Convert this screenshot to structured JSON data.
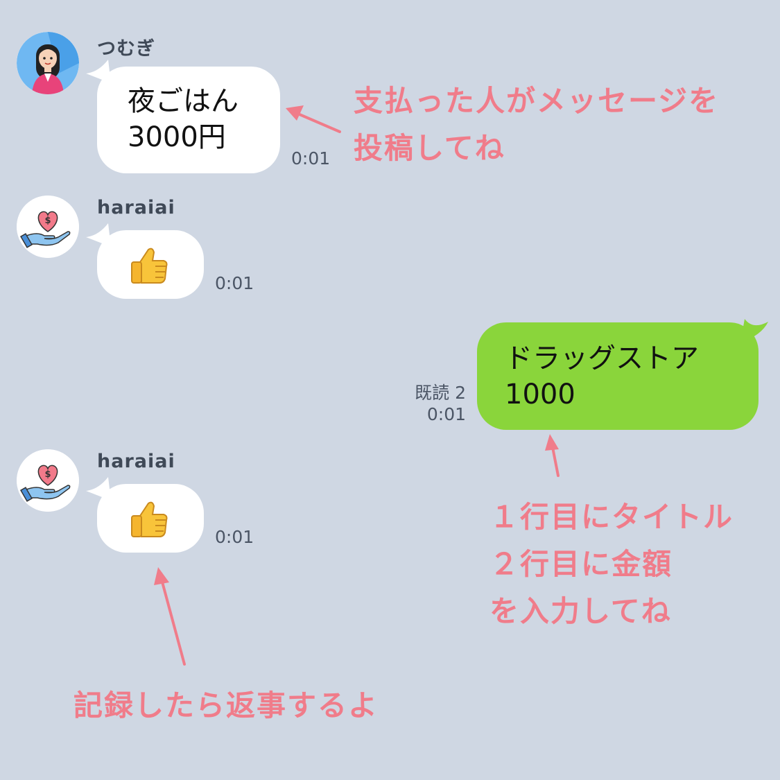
{
  "messages": [
    {
      "sender": "つむぎ",
      "text": "夜ごはん\n3000円",
      "time": "0:01"
    },
    {
      "sender": "haraiai",
      "emoji": "thumbs-up-icon",
      "time": "0:01"
    },
    {
      "self_text": "ドラッグストア\n1000",
      "read": "既読 2",
      "time": "0:01"
    },
    {
      "sender": "haraiai",
      "emoji": "thumbs-up-icon",
      "time": "0:01"
    }
  ],
  "annotations": {
    "post_message": "支払った人がメッセージを\n投稿してね",
    "input_format": "１行目にタイトル\n２行目に金額\nを入力してね",
    "reply_note": "記録したら返事するよ"
  },
  "colors": {
    "background": "#cfd7e3",
    "incoming_bubble": "#ffffff",
    "outgoing_bubble": "#8ad53b",
    "annotation": "#f07c8a"
  }
}
